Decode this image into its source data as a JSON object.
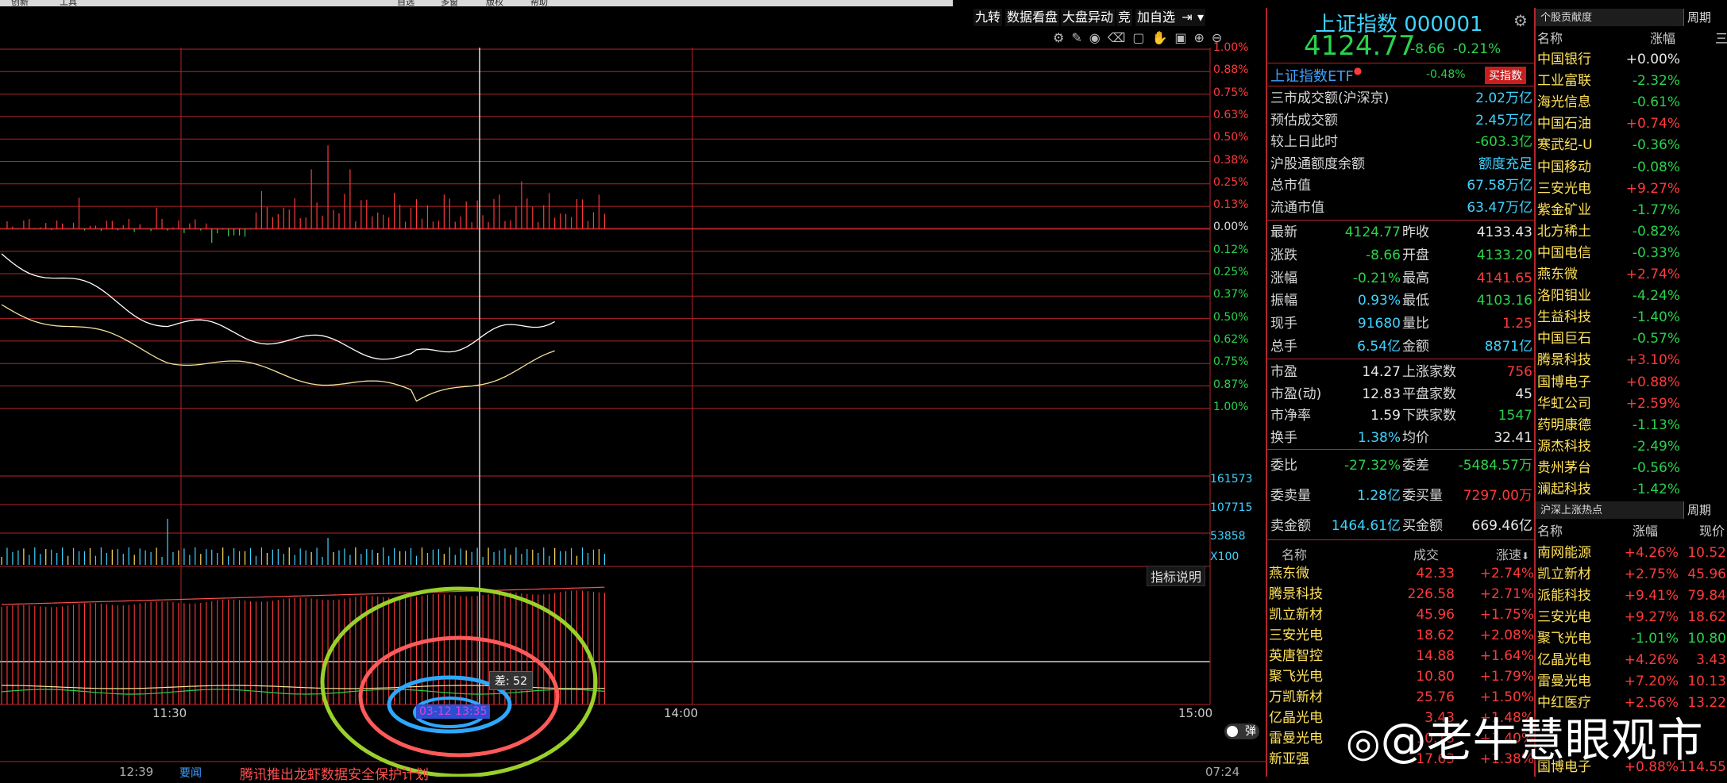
{
  "menubar": {
    "items": [
      "创新",
      "工具",
      "",
      "",
      "自选",
      "多窗",
      "版权",
      "帮助"
    ]
  },
  "toolbar": {
    "items": [
      "九转",
      "数据看盘",
      "大盘异动",
      "竞",
      "加自选"
    ]
  },
  "chart": {
    "right_axis_top": [
      "1.00%",
      "0.88%",
      "0.75%",
      "0.63%",
      "0.50%",
      "0.38%",
      "0.25%",
      "0.13%",
      "0.00%",
      "0.12%",
      "0.25%",
      "0.37%",
      "0.50%",
      "0.62%",
      "0.75%",
      "0.87%",
      "1.00%"
    ],
    "vol_axis": [
      "161573",
      "107715",
      "53858",
      "X100"
    ],
    "time_labels": [
      "11:30",
      "14:00",
      "15:00"
    ],
    "indicator_btn": "指标说明",
    "diff_tooltip": "差: 52",
    "time_tooltip": "03-12 13:35",
    "toggle_label": "弹",
    "ticker_time": "12:39",
    "ticker_tag": "要闻",
    "ticker_text": "腾讯推出龙虾数据安全保护计划",
    "right_time": "07:24"
  },
  "index": {
    "name": "上证指数",
    "code": "000001",
    "price": "4124.77",
    "change": "-8.66",
    "pct": "-0.21%",
    "etf_name": "上证指数ETF",
    "etf_pct": "-0.48%",
    "etf_btn": "买指数"
  },
  "stats1": [
    {
      "label": "三市成交额(沪深京)",
      "value": "2.02万亿"
    },
    {
      "label": "预估成交额",
      "value": "2.45万亿"
    },
    {
      "label": "较上日此时",
      "value": "-603.3亿"
    },
    {
      "label": "沪股通额度余额",
      "value": "额度充足"
    },
    {
      "label": "总市值",
      "value": "67.58万亿"
    },
    {
      "label": "流通市值",
      "value": "63.47万亿"
    }
  ],
  "stats2": [
    {
      "l1": "最新",
      "v1": "4124.77",
      "l2": "昨收",
      "v2": "4133.43"
    },
    {
      "l1": "涨跌",
      "v1": "-8.66",
      "l2": "开盘",
      "v2": "4133.20"
    },
    {
      "l1": "涨幅",
      "v1": "-0.21%",
      "l2": "最高",
      "v2": "4141.65"
    },
    {
      "l1": "振幅",
      "v1": "0.93%",
      "l2": "最低",
      "v2": "4103.16"
    },
    {
      "l1": "现手",
      "v1": "91680",
      "l2": "量比",
      "v2": "1.25"
    },
    {
      "l1": "总手",
      "v1": "6.54亿",
      "l2": "金额",
      "v2": "8871亿"
    }
  ],
  "stats3": [
    {
      "l1": "市盈",
      "v1": "14.27",
      "l2": "上涨家数",
      "v2": "756"
    },
    {
      "l1": "市盈(动)",
      "v1": "12.83",
      "l2": "平盘家数",
      "v2": "45"
    },
    {
      "l1": "市净率",
      "v1": "1.59",
      "l2": "下跌家数",
      "v2": "1547"
    },
    {
      "l1": "换手",
      "v1": "1.38%",
      "l2": "均价",
      "v2": "32.41"
    }
  ],
  "stats4": [
    {
      "l1": "委比",
      "v1": "-27.32%",
      "l2": "委差",
      "v2": "-5484.57万"
    },
    {
      "l1": "委卖量",
      "v1": "1.28亿",
      "l2": "委买量",
      "v2": "7297.00万"
    },
    {
      "l1": "卖金额",
      "v1": "1464.61亿",
      "l2": "买金额",
      "v2": "669.46亿"
    }
  ],
  "speed_list": {
    "headers": [
      "名称",
      "成交",
      "涨速"
    ],
    "rows": [
      {
        "name": "燕东微",
        "price": "42.33",
        "pct": "+2.74%"
      },
      {
        "name": "腾景科技",
        "price": "226.58",
        "pct": "+2.71%"
      },
      {
        "name": "凯立新材",
        "price": "45.96",
        "pct": "+1.75%"
      },
      {
        "name": "三安光电",
        "price": "18.62",
        "pct": "+2.08%"
      },
      {
        "name": "英唐智控",
        "price": "14.88",
        "pct": "+1.64%"
      },
      {
        "name": "聚飞光电",
        "price": "10.80",
        "pct": "+1.79%"
      },
      {
        "name": "万凯新材",
        "price": "25.76",
        "pct": "+1.50%"
      },
      {
        "name": "亿晶光电",
        "price": "3.43",
        "pct": "+1.48%"
      },
      {
        "name": "雷曼光电",
        "price": "10.13",
        "pct": "+1.40%"
      },
      {
        "name": "新亚强",
        "price": "17.63",
        "pct": "+1.38%"
      }
    ]
  },
  "contrib": {
    "title": "个股贡献度",
    "tab": "周期",
    "headers": [
      "名称",
      "涨幅",
      "三"
    ],
    "rows": [
      {
        "name": "中国银行",
        "pct": "+0.00%",
        "c": "w"
      },
      {
        "name": "工业富联",
        "pct": "-2.32%",
        "c": "g"
      },
      {
        "name": "海光信息",
        "pct": "-0.61%",
        "c": "g"
      },
      {
        "name": "中国石油",
        "pct": "+0.74%",
        "c": "r"
      },
      {
        "name": "寒武纪-U",
        "pct": "-0.36%",
        "c": "g"
      },
      {
        "name": "中国移动",
        "pct": "-0.08%",
        "c": "g"
      },
      {
        "name": "三安光电",
        "pct": "+9.27%",
        "c": "r"
      },
      {
        "name": "紫金矿业",
        "pct": "-1.77%",
        "c": "g"
      },
      {
        "name": "北方稀土",
        "pct": "-0.82%",
        "c": "g"
      },
      {
        "name": "中国电信",
        "pct": "-0.33%",
        "c": "g"
      },
      {
        "name": "燕东微",
        "pct": "+2.74%",
        "c": "r"
      },
      {
        "name": "洛阳钼业",
        "pct": "-4.24%",
        "c": "g"
      },
      {
        "name": "生益科技",
        "pct": "-1.40%",
        "c": "g"
      },
      {
        "name": "中国巨石",
        "pct": "-0.57%",
        "c": "g"
      },
      {
        "name": "腾景科技",
        "pct": "+3.10%",
        "c": "r"
      },
      {
        "name": "国博电子",
        "pct": "+0.88%",
        "c": "r"
      },
      {
        "name": "华虹公司",
        "pct": "+2.59%",
        "c": "r"
      },
      {
        "name": "药明康德",
        "pct": "-1.13%",
        "c": "g"
      },
      {
        "name": "源杰科技",
        "pct": "-2.49%",
        "c": "g"
      },
      {
        "name": "贵州茅台",
        "pct": "-0.56%",
        "c": "g"
      },
      {
        "name": "澜起科技",
        "pct": "-1.42%",
        "c": "g"
      }
    ]
  },
  "hot": {
    "title": "沪深上涨热点",
    "tab": "周期",
    "headers": [
      "名称",
      "涨幅",
      "现价"
    ],
    "rows": [
      {
        "name": "南网能源",
        "pct": "+4.26%",
        "price": "10.52",
        "c": "r"
      },
      {
        "name": "凯立新材",
        "pct": "+2.75%",
        "price": "45.96",
        "c": "r"
      },
      {
        "name": "派能科技",
        "pct": "+9.41%",
        "price": "79.84",
        "c": "r"
      },
      {
        "name": "三安光电",
        "pct": "+9.27%",
        "price": "18.62",
        "c": "r"
      },
      {
        "name": "聚飞光电",
        "pct": "-1.01%",
        "price": "10.80",
        "c": "g"
      },
      {
        "name": "亿晶光电",
        "pct": "+4.26%",
        "price": "3.43",
        "c": "r"
      },
      {
        "name": "雷曼光电",
        "pct": "+7.20%",
        "price": "10.13",
        "c": "r"
      },
      {
        "name": "中红医疗",
        "pct": "+2.56%",
        "price": "13.22",
        "c": "r"
      },
      {
        "name": "",
        "pct": "",
        "price": "",
        "c": "r"
      },
      {
        "name": "",
        "pct": "",
        "price": "",
        "c": "r"
      },
      {
        "name": "国博电子",
        "pct": "+0.88%",
        "price": "114.55",
        "c": "r"
      }
    ]
  },
  "watermark": "@老牛慧眼观市",
  "colors": {
    "up": "#ff3a3a",
    "down": "#2ad24b",
    "grid": "#b3252a",
    "price": "#ffffff",
    "avg": "#f5e39a"
  }
}
